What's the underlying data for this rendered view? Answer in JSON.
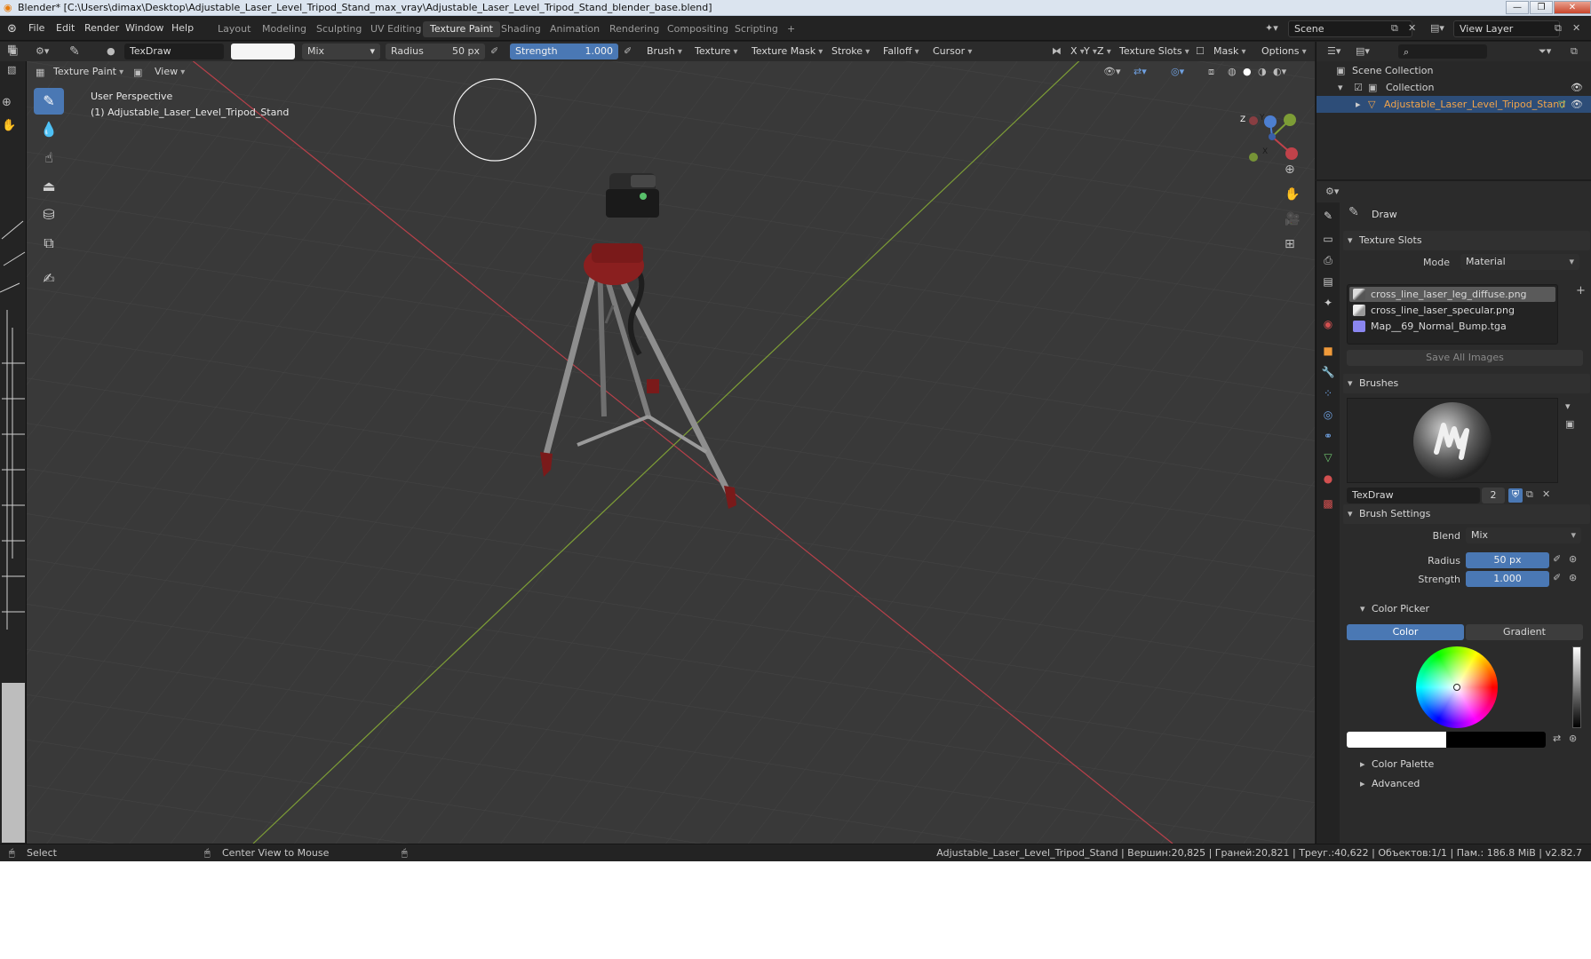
{
  "window": {
    "title": "Blender* [C:\\Users\\dimax\\Desktop\\Adjustable_Laser_Level_Tripod_Stand_max_vray\\Adjustable_Laser_Level_Tripod_Stand_blender_base.blend]",
    "min_label": "—",
    "max_label": "❐",
    "close_label": "✕"
  },
  "menu": {
    "items": [
      "File",
      "Edit",
      "Render",
      "Window",
      "Help"
    ]
  },
  "workspaces": {
    "tabs": [
      "Layout",
      "Modeling",
      "Sculpting",
      "UV Editing",
      "Texture Paint",
      "Shading",
      "Animation",
      "Rendering",
      "Compositing",
      "Scripting"
    ],
    "active": "Texture Paint",
    "add": "+"
  },
  "scene": {
    "name": "Scene",
    "view_layer": "View Layer"
  },
  "tool_header": {
    "brush_name": "TexDraw",
    "blend": "Mix",
    "radius_label": "Radius",
    "radius_value": "50 px",
    "strength_label": "Strength",
    "strength_value": "1.000",
    "menus": [
      "Brush",
      "Texture",
      "Texture Mask",
      "Stroke",
      "Falloff",
      "Cursor"
    ],
    "axes": [
      "X",
      "Y",
      "Z"
    ],
    "texture_slots": "Texture Slots",
    "mask": "Mask",
    "options": "Options"
  },
  "viewport": {
    "mode": "Texture Paint",
    "view_menu": "View",
    "perspective": "User Perspective",
    "object_label": "(1) Adjustable_Laser_Level_Tripod_Stand",
    "gizmo": {
      "x": "X",
      "y": "Y",
      "z": "Z"
    },
    "colors": {
      "grid_bg": "#393939",
      "x_axis": "#c0424a",
      "y_axis": "#7ea03a",
      "tripod_red": "#8a1f1f",
      "leg_gray": "#8c8c8c"
    }
  },
  "outliner": {
    "scene_collection": "Scene Collection",
    "collection": "Collection",
    "object": "Adjustable_Laser_Level_Tripod_Stand"
  },
  "properties": {
    "tool_name": "Draw",
    "texture_slots": {
      "title": "Texture Slots",
      "mode_label": "Mode",
      "mode_value": "Material",
      "slots": [
        "cross_line_laser_leg_diffuse.png",
        "cross_line_laser_specular.png",
        "Map__69_Normal_Bump.tga"
      ],
      "save_all": "Save All Images"
    },
    "brushes": {
      "title": "Brushes",
      "brush_name": "TexDraw",
      "users": "2"
    },
    "brush_settings": {
      "title": "Brush Settings",
      "blend_label": "Blend",
      "blend_value": "Mix",
      "radius_label": "Radius",
      "radius_value": "50 px",
      "strength_label": "Strength",
      "strength_value": "1.000"
    },
    "color_picker": {
      "title": "Color Picker",
      "color_tab": "Color",
      "gradient_tab": "Gradient",
      "primary_color": "#ffffff",
      "secondary_color": "#000000"
    },
    "color_palette": "Color Palette",
    "advanced": "Advanced"
  },
  "statusbar": {
    "select": "Select",
    "center_view": "Center View to Mouse",
    "stats": "Adjustable_Laser_Level_Tripod_Stand | Вершин:20,825 | Граней:20,821 | Треуг.:40,622 | Объектов:1/1 | Пам.: 186.8 MiB | v2.82.7"
  }
}
